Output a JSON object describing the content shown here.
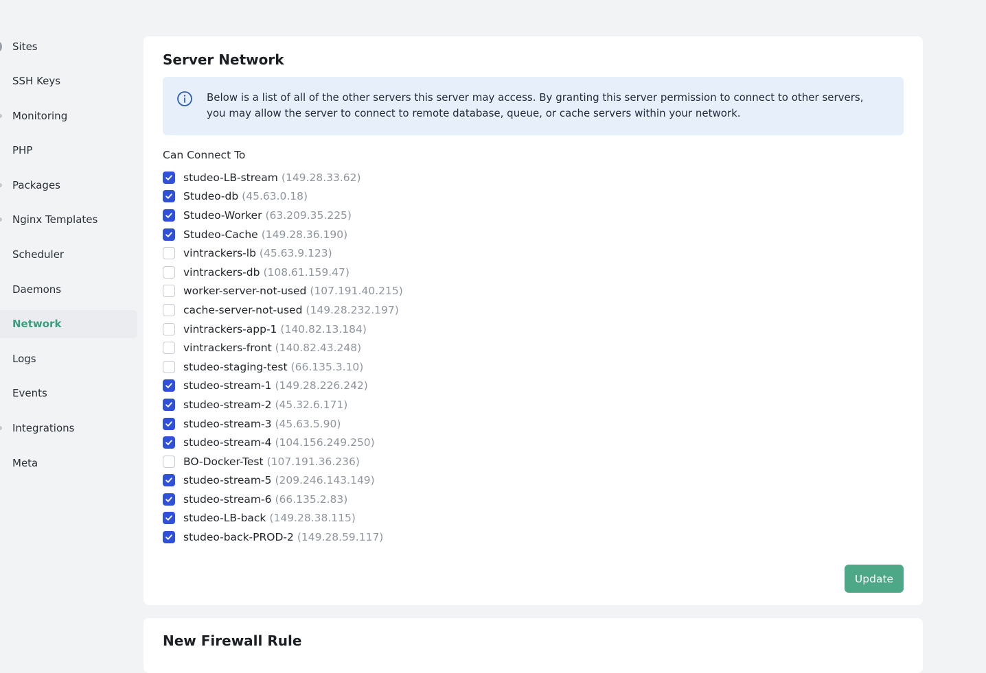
{
  "sidebar": {
    "items": [
      {
        "label": "Sites",
        "active": false
      },
      {
        "label": "SSH Keys",
        "active": false
      },
      {
        "label": "Monitoring",
        "active": false
      },
      {
        "label": "PHP",
        "active": false
      },
      {
        "label": "Packages",
        "active": false
      },
      {
        "label": "Nginx Templates",
        "active": false
      },
      {
        "label": "Scheduler",
        "active": false
      },
      {
        "label": "Daemons",
        "active": false
      },
      {
        "label": "Network",
        "active": true
      },
      {
        "label": "Logs",
        "active": false
      },
      {
        "label": "Events",
        "active": false
      },
      {
        "label": "Integrations",
        "active": false
      },
      {
        "label": "Meta",
        "active": false
      }
    ]
  },
  "network": {
    "title": "Server Network",
    "info_icon": "info-circle-icon",
    "info_text": "Below is a list of all of the other servers this server may access. By granting this server permission to connect to other servers, you may allow the server to connect to remote database, queue, or cache servers within your network.",
    "connect_label": "Can Connect To",
    "servers": [
      {
        "name": "studeo-LB-stream",
        "ip": "(149.28.33.62)",
        "checked": true
      },
      {
        "name": "Studeo-db",
        "ip": "(45.63.0.18)",
        "checked": true
      },
      {
        "name": "Studeo-Worker",
        "ip": "(63.209.35.225)",
        "checked": true
      },
      {
        "name": "Studeo-Cache",
        "ip": "(149.28.36.190)",
        "checked": true
      },
      {
        "name": "vintrackers-lb",
        "ip": "(45.63.9.123)",
        "checked": false
      },
      {
        "name": "vintrackers-db",
        "ip": "(108.61.159.47)",
        "checked": false
      },
      {
        "name": "worker-server-not-used",
        "ip": "(107.191.40.215)",
        "checked": false
      },
      {
        "name": "cache-server-not-used",
        "ip": "(149.28.232.197)",
        "checked": false
      },
      {
        "name": "vintrackers-app-1",
        "ip": "(140.82.13.184)",
        "checked": false
      },
      {
        "name": "vintrackers-front",
        "ip": "(140.82.43.248)",
        "checked": false
      },
      {
        "name": "studeo-staging-test",
        "ip": "(66.135.3.10)",
        "checked": false
      },
      {
        "name": "studeo-stream-1",
        "ip": "(149.28.226.242)",
        "checked": true
      },
      {
        "name": "studeo-stream-2",
        "ip": "(45.32.6.171)",
        "checked": true
      },
      {
        "name": "studeo-stream-3",
        "ip": "(45.63.5.90)",
        "checked": true
      },
      {
        "name": "studeo-stream-4",
        "ip": "(104.156.249.250)",
        "checked": true
      },
      {
        "name": "BO-Docker-Test",
        "ip": "(107.191.36.236)",
        "checked": false
      },
      {
        "name": "studeo-stream-5",
        "ip": "(209.246.143.149)",
        "checked": true
      },
      {
        "name": "studeo-stream-6",
        "ip": "(66.135.2.83)",
        "checked": true
      },
      {
        "name": "studeo-LB-back",
        "ip": "(149.28.38.115)",
        "checked": true
      },
      {
        "name": "studeo-back-PROD-2",
        "ip": "(149.28.59.117)",
        "checked": true
      }
    ],
    "update_label": "Update"
  },
  "firewall": {
    "title": "New Firewall Rule"
  },
  "colors": {
    "accent": "#4da887",
    "active_nav": "#3a9d7c",
    "checkbox_checked": "#2f51d8",
    "info_bg": "#e6effa",
    "info_icon": "#2f5fb3"
  }
}
